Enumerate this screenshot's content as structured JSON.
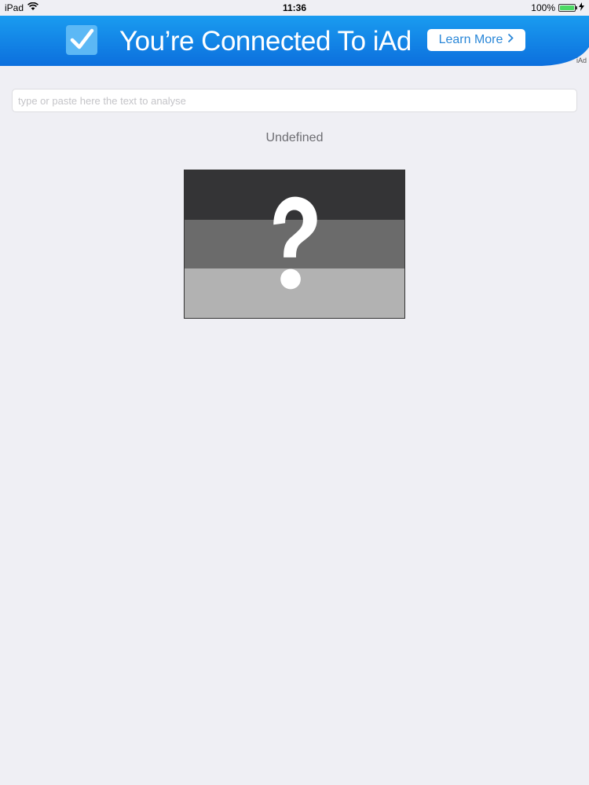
{
  "status_bar": {
    "device": "iPad",
    "time": "11:36",
    "battery": "100%",
    "battery_level": 1.0
  },
  "ad": {
    "title": "You’re Connected To iAd",
    "button_label": "Learn More",
    "badge": "iAd",
    "colors": {
      "top": "#1a9cf0",
      "bottom": "#0c6fdd"
    }
  },
  "search": {
    "value": "",
    "placeholder": "type or paste here the text to analyse"
  },
  "result": {
    "label": "Undefined",
    "flag_colors": [
      "#343436",
      "#6b6b6b",
      "#b2b2b2"
    ],
    "flag_icon": "question-mark-icon"
  }
}
